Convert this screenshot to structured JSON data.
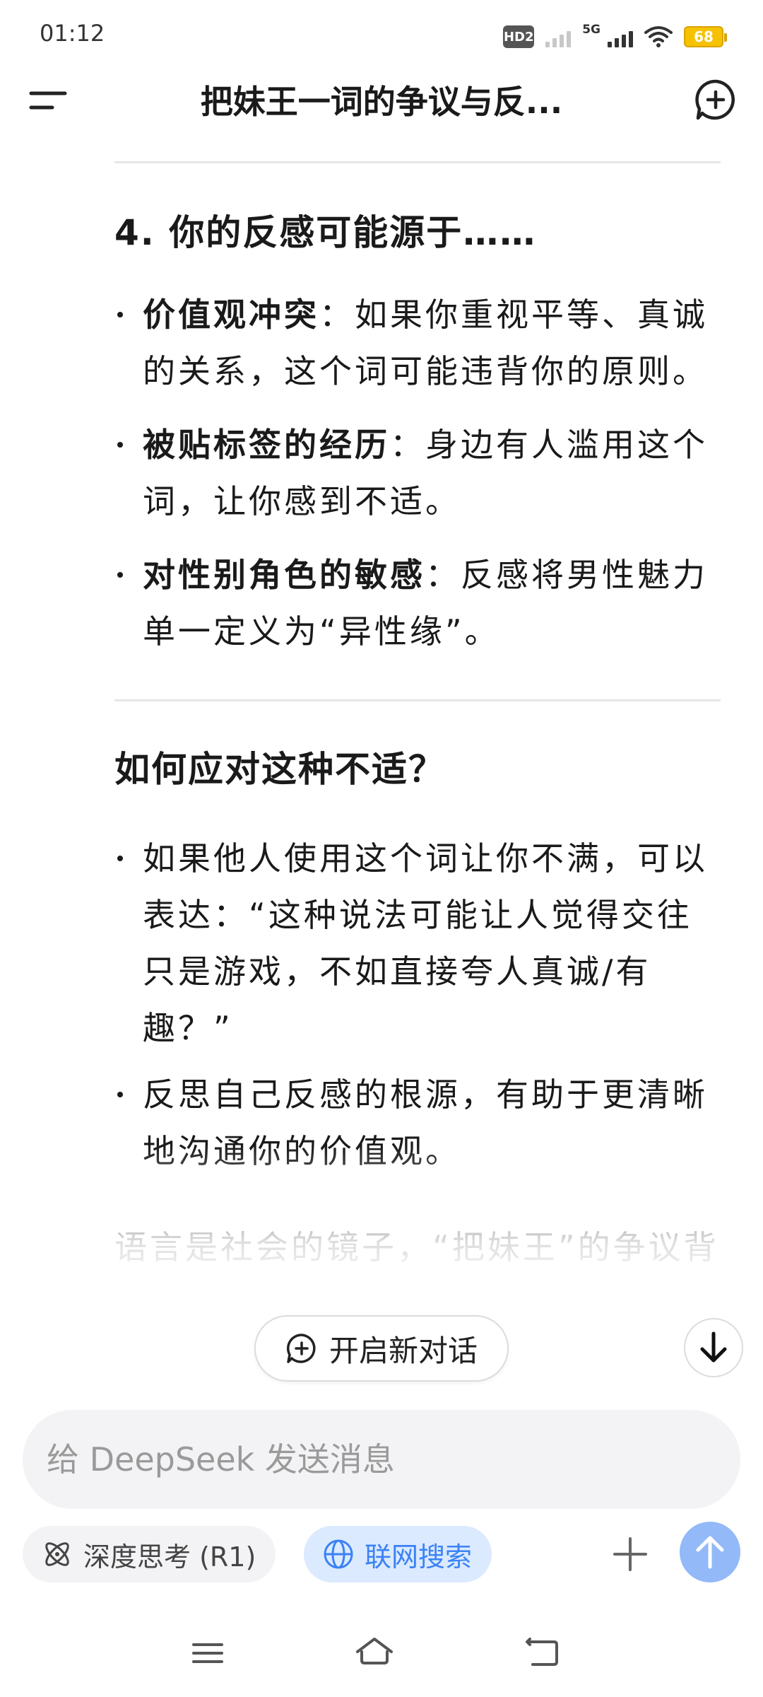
{
  "status_bar": {
    "time": "01:12",
    "hd_label": "HD2",
    "network_label": "5G",
    "battery_level": "68",
    "battery_color": "#f6c200"
  },
  "header": {
    "title": "把妹王一词的争议与反...",
    "menu_icon": "menu-icon",
    "new_chat_icon": "new-chat-icon"
  },
  "content": {
    "section4": {
      "heading": "4. 你的反感可能源于……",
      "items": [
        {
          "term": "价值观冲突",
          "text": "：如果你重视平等、真诚的关系，这个词可能违背你的原则。"
        },
        {
          "term": "被贴标签的经历",
          "text": "：身边有人滥用这个词，让你感到不适。"
        },
        {
          "term": "对性别角色的敏感",
          "text": "：反感将男性魅力单一定义为“异性缘”。"
        }
      ]
    },
    "section5": {
      "heading": "如何应对这种不适？",
      "items": [
        {
          "text": "如果他人使用这个词让你不满，可以表达：“这种说法可能让人觉得交往只是游戏，不如直接夸人真诚/有趣？”"
        },
        {
          "text": "反思自己反感的根源，有助于更清晰地沟通你的价值观。"
        }
      ]
    },
    "closing": "语言是社会的镜子，“把妹王”的争议背后，是人们对健康关系定义的"
  },
  "floating": {
    "new_dialog_label": "开启新对话"
  },
  "composer": {
    "placeholder": "给 DeepSeek 发送消息",
    "deep_think_label": "深度思考 (R1)",
    "web_search_label": "联网搜索",
    "accent_color": "#3b82f6",
    "send_color": "#93b9f8"
  }
}
